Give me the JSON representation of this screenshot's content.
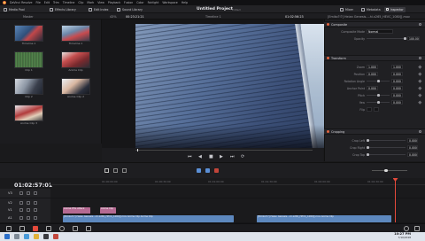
{
  "menubar": {
    "items": [
      "DaVinci Resolve",
      "File",
      "Edit",
      "Trim",
      "Timeline",
      "Clip",
      "Mark",
      "View",
      "Playback",
      "Fusion",
      "Color",
      "Fairlight",
      "Workspace",
      "Help"
    ]
  },
  "toolbar": {
    "media_pool": "Media Pool",
    "effects_library": "Effects Library",
    "edit_index": "Edit Index",
    "sound_library": "Sound Library",
    "project_title": "Untitled Project",
    "project_status": "Edited",
    "mixer": "Mixer",
    "metadata": "Metadata",
    "inspector": "Inspector"
  },
  "subbar": {
    "bin": "Master",
    "zoom": "43%",
    "source_tc": "00:23:21:21",
    "timeline_name": "Timeline 1",
    "record_tc": "01:02:56:23",
    "clip_name": "[Emiko?!?] Heian Genesis...-hi.x265_HEVC_1080][.mov"
  },
  "media_pool": {
    "clips": [
      {
        "label": "Timeline 1",
        "style": "t-anime1"
      },
      {
        "label": "Timeline 1",
        "style": "t-anime2"
      },
      {
        "label": "Clip 1",
        "style": "t-green"
      },
      {
        "label": "Anime Clip",
        "style": "t-red"
      },
      {
        "label": "Clip 2",
        "style": "t-people"
      },
      {
        "label": "Anime Clip 2",
        "style": "t-char"
      },
      {
        "label": "Anime Clip 3",
        "style": "t-group"
      }
    ]
  },
  "viewer": {
    "transport": [
      "⏮",
      "◀",
      "■",
      "▶",
      "⏭",
      "⟳"
    ]
  },
  "inspector": {
    "composite": {
      "title": "Composite",
      "mode_label": "Composite Mode",
      "mode_value": "Normal",
      "opacity_label": "Opacity",
      "opacity_value": "100.00"
    },
    "transform": {
      "title": "Transform",
      "rows": [
        {
          "label": "Zoom",
          "x": "1.000",
          "y": "1.000"
        },
        {
          "label": "Position",
          "x": "0.000",
          "y": "0.000"
        },
        {
          "label": "Rotation Angle",
          "x": "0.000",
          "y": ""
        },
        {
          "label": "Anchor Point",
          "x": "0.000",
          "y": "0.000"
        },
        {
          "label": "Pitch",
          "x": "0.000",
          "y": ""
        },
        {
          "label": "Yaw",
          "x": "0.000",
          "y": ""
        },
        {
          "label": "Flip",
          "x": "",
          "y": ""
        }
      ]
    },
    "cropping": {
      "title": "Cropping",
      "rows": [
        {
          "label": "Crop Left",
          "x": "0.000"
        },
        {
          "label": "Crop Right",
          "x": "0.000"
        },
        {
          "label": "Crop Top",
          "x": "0.000"
        }
      ]
    }
  },
  "timeline": {
    "timecode": "01:02:57:01",
    "ruler": [
      "01:00:00:00",
      "01:00:30:00",
      "01:01:00:00",
      "01:01:30:00",
      "01:02:00:00",
      "01:02:30:00"
    ],
    "tracks": [
      {
        "name": "V3"
      },
      {
        "name": "V2"
      },
      {
        "name": "V1"
      },
      {
        "name": "A1"
      }
    ],
    "clips": {
      "v1_a": "Animé PTG Attack",
      "v1_b": "Anime Clip",
      "a1_a": "[Emiko?!?] Heian Genesis...-hi.x265_HEVC_1080][.mov  Anime Clip  Anime Clip",
      "a1_b": "[Emiko?!?] Heian Genesis...-hi.x265_HEVC_1080][.mov  Anime Clip"
    }
  },
  "taskbar": {
    "time": "10:27 PM",
    "date": "7/10/2018"
  }
}
